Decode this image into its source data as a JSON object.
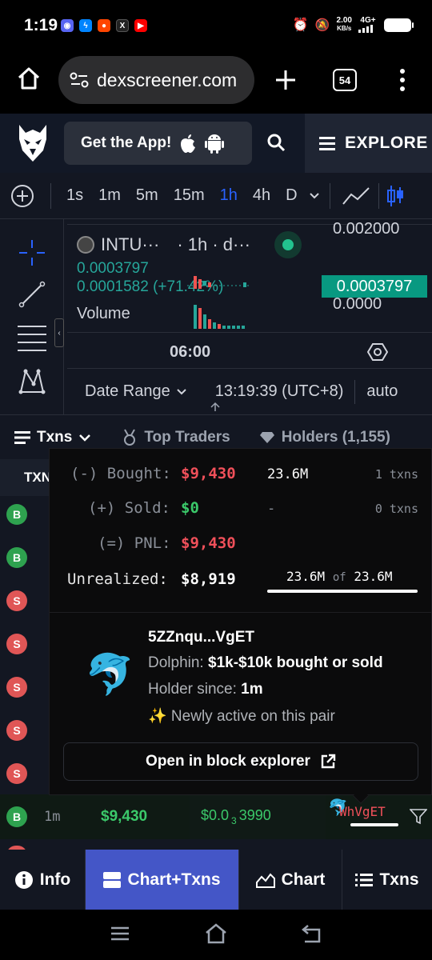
{
  "status_bar": {
    "time": "1:19",
    "net_speed_value": "2.00",
    "net_speed_unit": "KB/s",
    "network": "4G+"
  },
  "browser": {
    "url": "dexscreener.com",
    "tab_count": "54"
  },
  "site_header": {
    "get_app_label": "Get the App!",
    "explore_label": "EXPLORE"
  },
  "timeframes": {
    "items": [
      "1s",
      "1m",
      "5m",
      "15m",
      "1h",
      "4h",
      "D"
    ],
    "active": "1h"
  },
  "chart": {
    "symbol": "INTU···",
    "interval_text": "· 1h · d···",
    "price": "0.0003797",
    "change": "0.0001582 (+71.42%)",
    "volume_label": "Volume",
    "price_tag": "0.0003797",
    "axis_top": "0.002000",
    "axis_mid": "0.0000",
    "time_label": "06:00",
    "date_range_label": "Date Range",
    "clock": "13:19:39 (UTC+8)",
    "scale_mode": "auto"
  },
  "tx_tabs": {
    "txns": "Txns",
    "top_traders": "Top Traders",
    "holders": "Holders (1,155)"
  },
  "table": {
    "header_fragment": "TXN",
    "rows": [
      {
        "type": "B"
      },
      {
        "type": "B"
      },
      {
        "type": "S"
      },
      {
        "type": "S"
      },
      {
        "type": "S"
      },
      {
        "type": "S"
      },
      {
        "type": "S"
      }
    ],
    "last_row": {
      "type": "B",
      "age": "1m",
      "usd": "$9,430",
      "price_prefix": "$0.0",
      "price_zeros": "3",
      "price_suffix": "3990",
      "maker": "WhVgET"
    }
  },
  "popover": {
    "bought_label": "(-) Bought:",
    "bought_value": "$9,430",
    "bought_amount": "23.6M",
    "bought_txns": "1 txns",
    "sold_label": "(+) Sold:",
    "sold_value": "$0",
    "sold_amount": "-",
    "sold_txns": "0 txns",
    "pnl_label": "(=) PNL:",
    "pnl_value": "$9,430",
    "unrealized_label": "Unrealized:",
    "unrealized_value": "$8,919",
    "holding_now": "23.6M",
    "holding_of": "of",
    "holding_total": "23.6M",
    "holding_fraction": 1.0,
    "wallet": "5ZZnqu...VgET",
    "dolphin_label": "Dolphin:",
    "dolphin_value": "$1k-$10k bought or sold",
    "holder_since_label": "Holder since:",
    "holder_since_value": "1m",
    "newly_active": "✨ Newly active on this pair",
    "open_explorer": "Open in block explorer"
  },
  "bottom_nav": {
    "info": "Info",
    "chart_txns": "Chart+Txns",
    "chart": "Chart",
    "txns": "Txns"
  },
  "colors": {
    "accent_blue": "#2962ff",
    "nav_active": "#4456c7",
    "buy_green": "#2ea24f",
    "sell_red": "#e05656",
    "price_tag": "#089981"
  }
}
